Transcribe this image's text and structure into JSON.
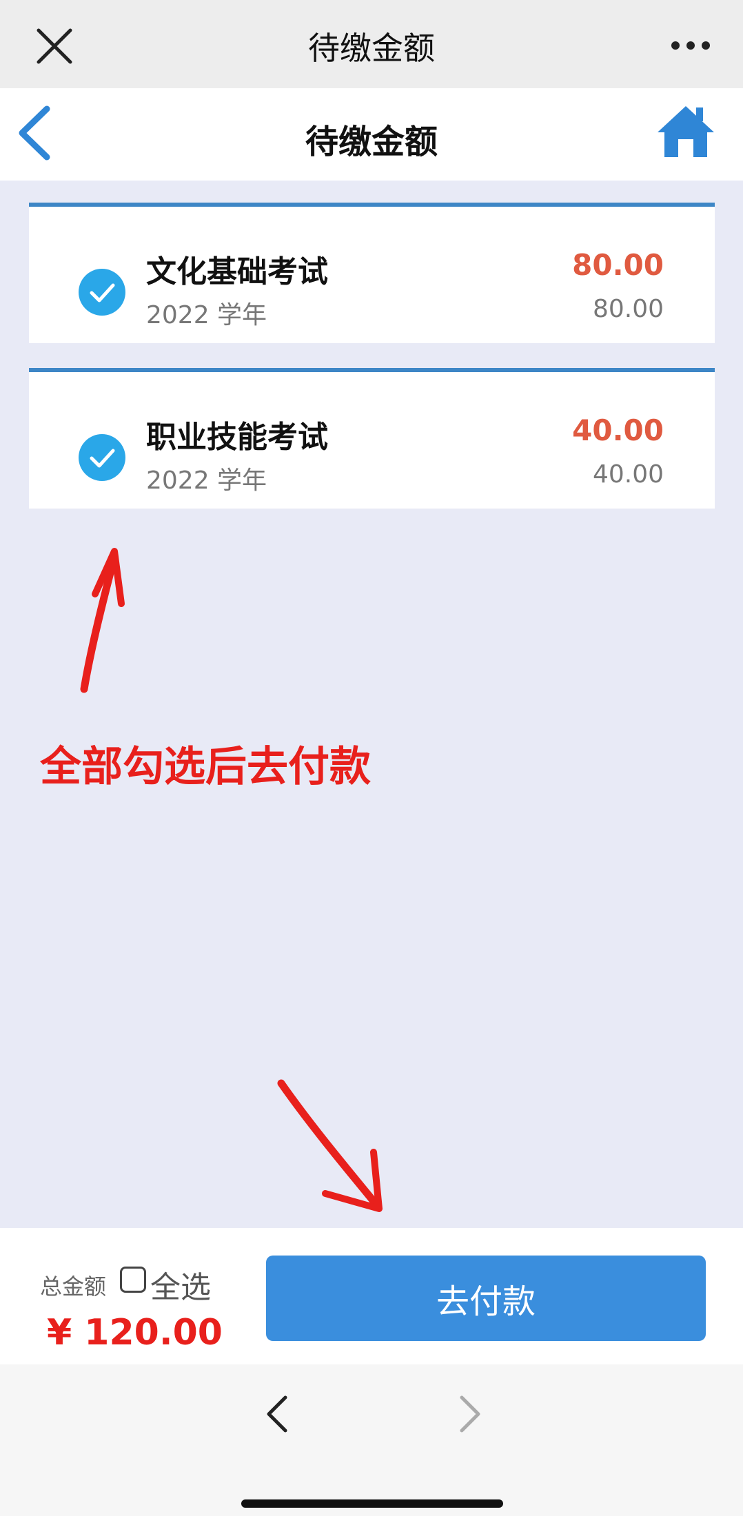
{
  "topbar": {
    "title": "待缴金额",
    "close_icon": "close-icon",
    "more_icon": "more-icon"
  },
  "appbar": {
    "title": "待缴金额",
    "back_icon": "chevron-left-icon",
    "home_icon": "home-icon"
  },
  "items": [
    {
      "name": "文化基础考试",
      "year": "2022 学年",
      "amount": "80.00",
      "sub_amount": "80.00",
      "checked": true
    },
    {
      "name": "职业技能考试",
      "year": "2022 学年",
      "amount": "40.00",
      "sub_amount": "40.00",
      "checked": true
    }
  ],
  "annotation": {
    "text": "全部勾选后去付款",
    "color": "#e8201c"
  },
  "footer": {
    "total_label": "总金额",
    "select_all_label": "全选",
    "total_amount": "¥ 120.00",
    "pay_button": "去付款"
  },
  "colors": {
    "accent": "#3a8edd",
    "check": "#2aa7e8",
    "amount": "#e05a40",
    "card_border": "#3d86c6"
  }
}
